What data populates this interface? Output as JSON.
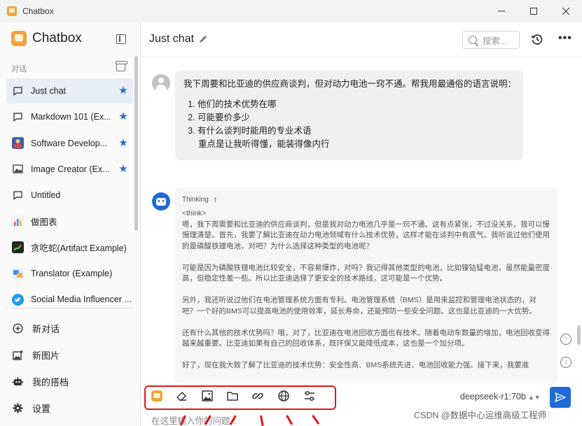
{
  "window": {
    "title": "Chatbox",
    "controls": [
      "minimize",
      "maximize",
      "close"
    ]
  },
  "sidebar": {
    "brand": "Chatbox",
    "section_label": "对话",
    "conversations": [
      {
        "label": "Just chat",
        "icon": "chat-bubble-icon",
        "starred": true,
        "active": true
      },
      {
        "label": "Markdown 101 (Ex...",
        "icon": "chat-bubble-icon",
        "starred": true,
        "active": false
      },
      {
        "label": "Software Develop...",
        "icon": "developer-avatar-icon",
        "starred": true,
        "active": false
      },
      {
        "label": "Image Creator (Ex...",
        "icon": "image-icon",
        "starred": true,
        "active": false
      },
      {
        "label": "Untitled",
        "icon": "chat-bubble-icon",
        "starred": false,
        "active": false
      },
      {
        "label": "做图表",
        "icon": "chart-avatar-icon",
        "starred": false,
        "active": false
      },
      {
        "label": "贪吃蛇(Artifact Example)",
        "icon": "snake-avatar-icon",
        "starred": false,
        "active": false
      },
      {
        "label": "Translator (Example)",
        "icon": "translator-avatar-icon",
        "starred": false,
        "active": false
      },
      {
        "label": "Social Media Influencer ...",
        "icon": "twitter-avatar-icon",
        "starred": false,
        "active": false
      }
    ],
    "nav": [
      {
        "label": "新对话",
        "icon": "add-circle-icon"
      },
      {
        "label": "新图片",
        "icon": "image-add-icon"
      },
      {
        "label": "我的搭档",
        "icon": "robot-icon"
      },
      {
        "label": "设置",
        "icon": "gear-icon"
      }
    ]
  },
  "header": {
    "title": "Just chat",
    "search_placeholder": "搜索..."
  },
  "messages": {
    "user": {
      "intro": "我下周要和比亚迪的供应商谈判，但对动力电池一窍不通。帮我用最通俗的语言说明：",
      "items": [
        "他们的技术优势在哪",
        "可能要价多少",
        "有什么谈判时能用的专业术语"
      ],
      "note": "重点是让我听得懂，能装得像内行"
    },
    "assistant": {
      "thinking_label": "Thinking",
      "tag": "<think>",
      "paragraphs": [
        "嗯，我下周需要和比亚迪的供应商谈判，但是我对动力电池几乎是一窍不通。这有点紧张，不过没关系，我可以慢慢理清楚。首先，我要了解比亚迪在动力电池领域有什么技术优势，这样才能在谈判中有底气。我听说过他们使用的是磷酸铁锂电池，对吧？为什么选择这种类型的电池呢？",
        "可能是因为磷酸铁锂电池比较安全，不容易爆炸，对吗？我记得其他类型的电池，比如镍钴锰电池，虽然能量密度高，但稳定性差一些。所以比亚迪选择了更安全的技术路线，这可能是一个优势。",
        "另外，我还听说过他们在电池管理系统方面有专利。电池管理系统（BMS）是用来监控和管理电池状态的，对吧？一个好的BMS可以提高电池的使用效率，延长寿命，还能预防一些安全问题。这也是比亚迪的一大优势。",
        "还有什么其他的技术优势吗？哦，对了，比亚迪在电池回收方面也有技术。随着电动车数量的增加，电池回收变得越来越重要。比亚迪如果有自己的回收体系，既环保又能降低成本，这也是一个加分项。",
        "好了，现在我大致了解了比亚迪的技术优势：安全性高、BMS系统先进、电池回收能力强。接下来，我要准"
      ]
    }
  },
  "composer": {
    "tools": [
      "chatbox-logo-icon",
      "eraser-icon",
      "image-icon",
      "folder-icon",
      "link-icon",
      "globe-icon",
      "settings-sliders-icon"
    ],
    "model": "deepseek-r1:70b",
    "placeholder": "在这里输入你的问题..."
  },
  "watermark": "CSDN @数据中心运维高级工程师",
  "colors": {
    "accent": "#1f6bd6",
    "highlight": "#e0161a",
    "brand": "#f3a33b"
  }
}
